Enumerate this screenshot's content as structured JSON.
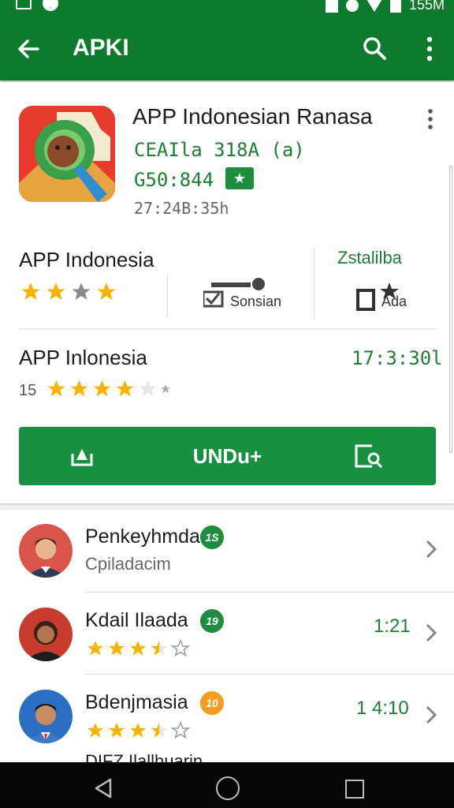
{
  "status_bar": {
    "time": "155M"
  },
  "appbar": {
    "title": "APKI"
  },
  "app": {
    "name": "APP Indonesian Ranasa",
    "subtitle": "CEAIla 318A (a)",
    "price": "G50:844",
    "time": "27:24B:35h"
  },
  "stats": {
    "title": "APP Indonesia",
    "solution_label": "Sonsian",
    "install_label": "Zstalilba",
    "install_sub": "Ada"
  },
  "row2": {
    "title": "APP Inlonesia",
    "time": "17:3:30l",
    "count": "15"
  },
  "download_button": {
    "label": "UNDu+"
  },
  "list": [
    {
      "title": "Penkeyhmdar",
      "subtitle": "Cpiladacim",
      "badge": "1S",
      "badge_color": "#1e8e3e",
      "time": "",
      "rating": 0
    },
    {
      "title": "Kdail Ilaada",
      "subtitle": "",
      "badge": "19",
      "badge_color": "#1e8e3e",
      "time": "1:21",
      "rating": 3.5
    },
    {
      "title": "Bdenjmasia",
      "subtitle": "",
      "badge": "10",
      "badge_color": "#f29d1c",
      "time": "1 4:10",
      "rating": 3.5
    }
  ],
  "peek_text": "DIFZ Ilallhuarin",
  "colors": {
    "primary": "#0d7a2c",
    "accent_green": "#1e7e34",
    "star": "#f4b400",
    "button": "#17903f"
  }
}
